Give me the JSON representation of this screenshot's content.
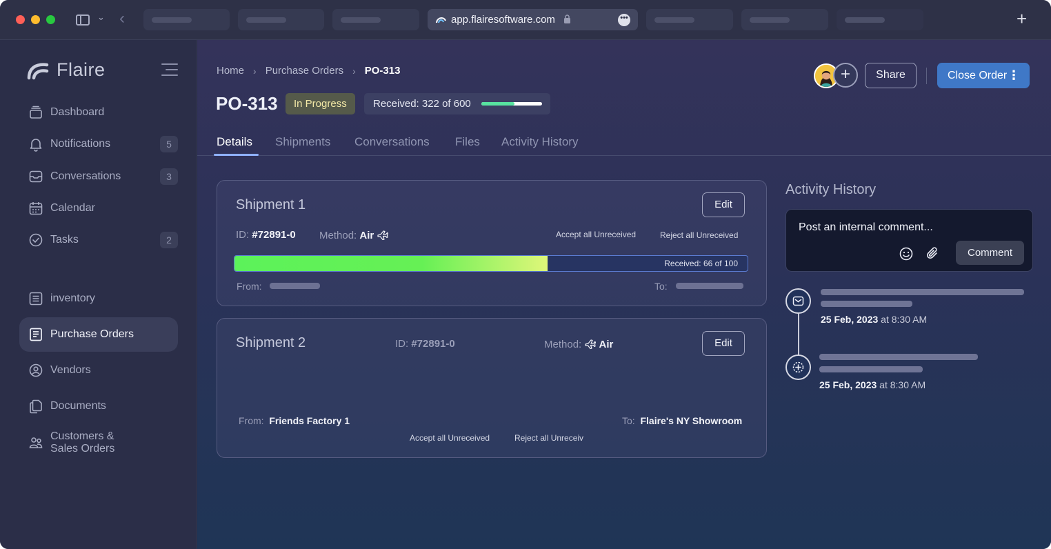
{
  "browser": {
    "url": "app.flairesoftware.com",
    "more_icon": "ellipsis-icon",
    "new_tab_icon": "plus-icon"
  },
  "brand": {
    "name": "Flaire"
  },
  "sidebar": {
    "items": [
      {
        "label": "Dashboard",
        "icon": "dashboard-icon",
        "badge": ""
      },
      {
        "label": "Notifications",
        "icon": "bell-icon",
        "badge": "5"
      },
      {
        "label": "Conversations",
        "icon": "inbox-icon",
        "badge": "3"
      },
      {
        "label": "Calendar",
        "icon": "calendar-icon",
        "badge": ""
      },
      {
        "label": "Tasks",
        "icon": "check-circle-icon",
        "badge": "2"
      },
      {
        "label": "inventory",
        "icon": "list-icon",
        "badge": ""
      },
      {
        "label": "Purchase Orders",
        "icon": "receipt-icon",
        "badge": "",
        "active": true
      },
      {
        "label": "Vendors",
        "icon": "vendor-icon",
        "badge": ""
      },
      {
        "label": "Documents",
        "icon": "documents-icon",
        "badge": ""
      },
      {
        "label": "Customers &\nSales Orders",
        "icon": "customers-icon",
        "badge": ""
      }
    ]
  },
  "breadcrumb": {
    "home": "Home",
    "section": "Purchase Orders",
    "current": "PO-313"
  },
  "order": {
    "title": "PO-313",
    "status": "In Progress",
    "received_label": "Received:",
    "received_value": "322 of 600",
    "received_fraction": 0.54
  },
  "header_actions": {
    "share": "Share",
    "close_order": "Close Order"
  },
  "tabs": [
    "Details",
    "Shipments",
    "Conversations",
    "Files",
    "Activity History"
  ],
  "shipments": [
    {
      "title": "Shipment 1",
      "edit": "Edit",
      "id_label": "ID:",
      "id": "#72891-0",
      "method_label": "Method:",
      "method": "Air",
      "accept": "Accept all Unreceived",
      "reject": "Reject all Unreceived",
      "progress_text": "Received: 66 of 100",
      "progress_fraction": 0.61,
      "from_label": "From:",
      "to_label": "To:"
    },
    {
      "title": "Shipment 2",
      "edit": "Edit",
      "id_label": "ID:",
      "id": "#72891-0",
      "method_label": "Method:",
      "method": "Air",
      "from_label": "From:",
      "from": "Friends Factory 1",
      "to_label": "To:",
      "to": "Flaire's NY Showroom",
      "accept": "Accept all Unreceived",
      "reject": "Reject all Unreceiv"
    }
  ],
  "activity": {
    "title": "Activity History",
    "placeholder": "Post an internal comment...",
    "comment_button": "Comment",
    "entries": [
      {
        "date": "25 Feb, 2023",
        "time": "at 8:30 AM",
        "icon": "envelope-icon"
      },
      {
        "date": "25 Feb, 2023",
        "time": "at 8:30 AM",
        "icon": "plus-circle-icon"
      }
    ]
  },
  "colors": {
    "accent": "#3f78c7",
    "status_in_progress": "#f3e9a7",
    "progress_green": "#5cf25a",
    "progress_yellow": "#dff679"
  }
}
